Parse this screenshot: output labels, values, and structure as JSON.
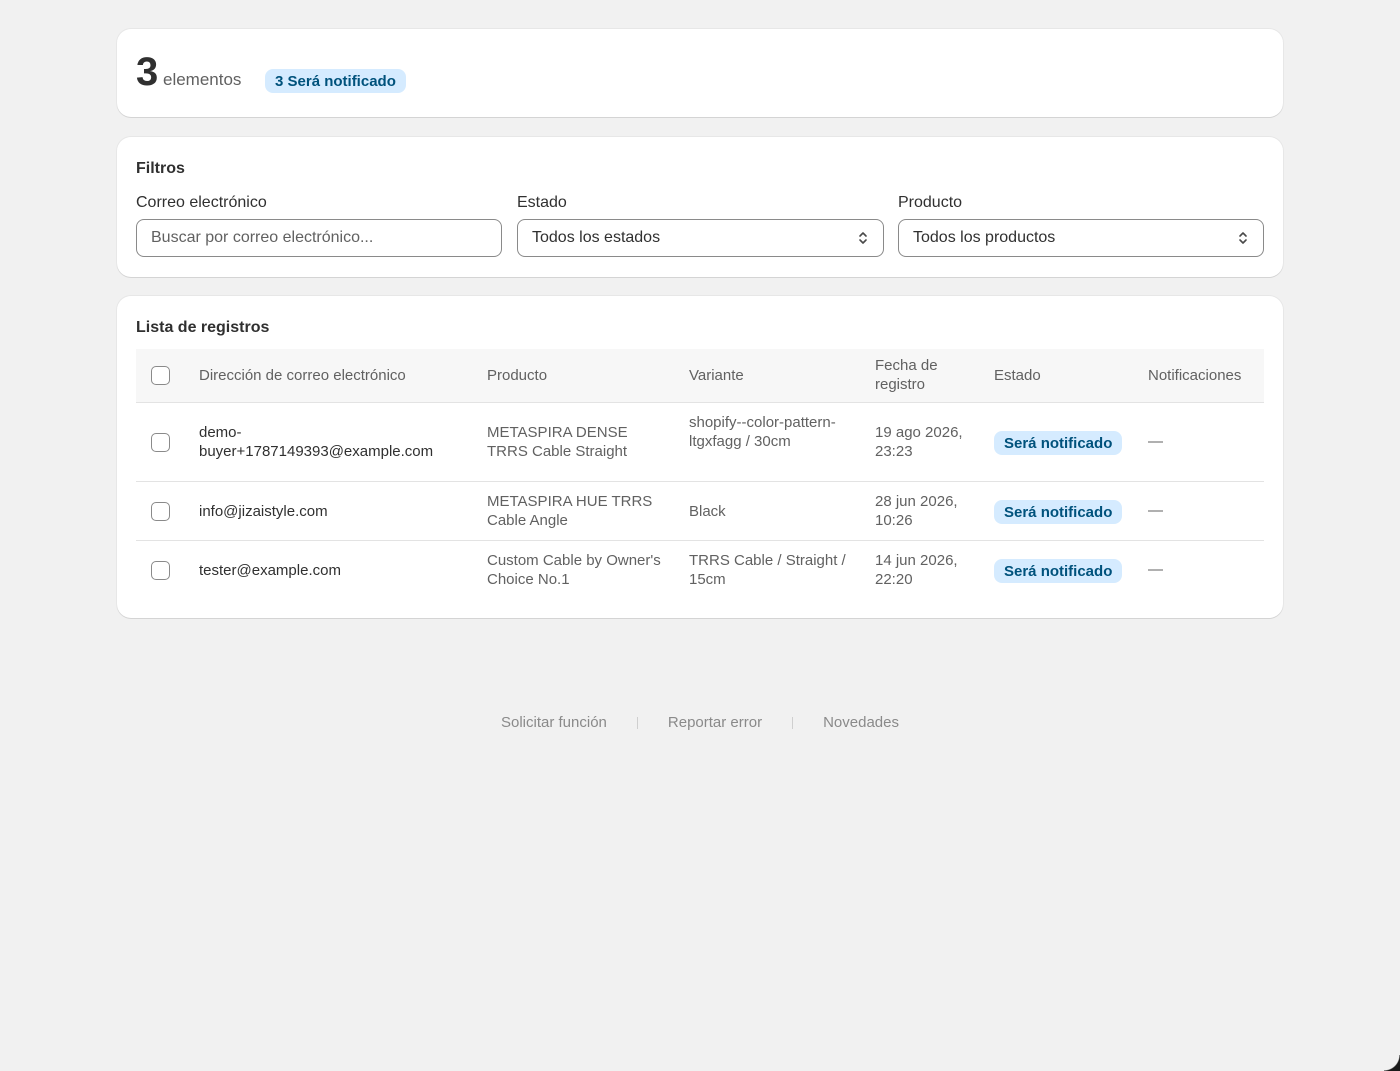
{
  "summary": {
    "count": "3",
    "count_label": "elementos",
    "badge": "3 Será notificado"
  },
  "filters": {
    "title": "Filtros",
    "email_label": "Correo electrónico",
    "email_placeholder": "Buscar por correo electrónico...",
    "status_label": "Estado",
    "status_value": "Todos los estados",
    "product_label": "Producto",
    "product_value": "Todos los productos"
  },
  "list": {
    "title": "Lista de registros",
    "columns": {
      "email": "Dirección de correo electrónico",
      "product": "Producto",
      "variant": "Variante",
      "date": "Fecha de registro",
      "status": "Estado",
      "notifications": "Notificaciones"
    },
    "rows": [
      {
        "email": "demo-buyer+1787149393@example.com",
        "product": "METASPIRA DENSE TRRS Cable Straight",
        "variant": "shopify--color-pattern-ltgxfagg / 30cm",
        "date": "19 ago 2026, 23:23",
        "status": "Será notificado",
        "notifications": "—"
      },
      {
        "email": "info@jizaistyle.com",
        "product": "METASPIRA HUE TRRS Cable Angle",
        "variant": "Black",
        "date": "28 jun 2026, 10:26",
        "status": "Será notificado",
        "notifications": "—"
      },
      {
        "email": "tester@example.com",
        "product": "Custom Cable by Owner's Choice No.1",
        "variant": "TRRS Cable / Straight / 15cm",
        "date": "14 jun 2026, 22:20",
        "status": "Será notificado",
        "notifications": "—"
      }
    ]
  },
  "footer": {
    "links": [
      "Solicitar función",
      "Reportar error",
      "Novedades"
    ]
  },
  "colors": {
    "page_bg": "#f1f1f1",
    "badge_bg": "#d5ebff",
    "badge_text": "#00527c"
  }
}
